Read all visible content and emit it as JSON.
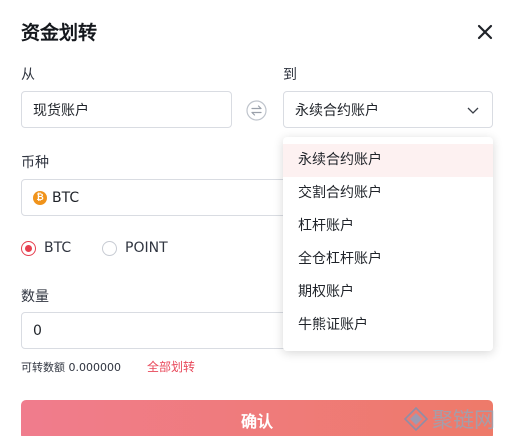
{
  "dialog": {
    "title": "资金划转",
    "from_label": "从",
    "to_label": "到",
    "from_value": "现货账户",
    "to_value": "永续合约账户",
    "currency_label": "币种",
    "coin_icon_glyph": "₿",
    "coin_value": "BTC",
    "radio_options": [
      {
        "label": "BTC",
        "checked": true
      },
      {
        "label": "POINT",
        "checked": false
      }
    ],
    "amount_label": "数量",
    "amount_value": "0",
    "available_text": "可转数额 0.000000",
    "transfer_all_label": "全部划转",
    "confirm_label": "确认"
  },
  "dropdown": {
    "options": [
      "永续合约账户",
      "交割合约账户",
      "杠杆账户",
      "全仓杠杆账户",
      "期权账户",
      "牛熊证账户"
    ],
    "selected_index": 0
  },
  "watermark": {
    "text": "聚链网"
  },
  "colors": {
    "accent": "#e63f4f",
    "button_start": "#f07c8d",
    "button_end": "#ee7a69",
    "coin": "#f0931b"
  }
}
